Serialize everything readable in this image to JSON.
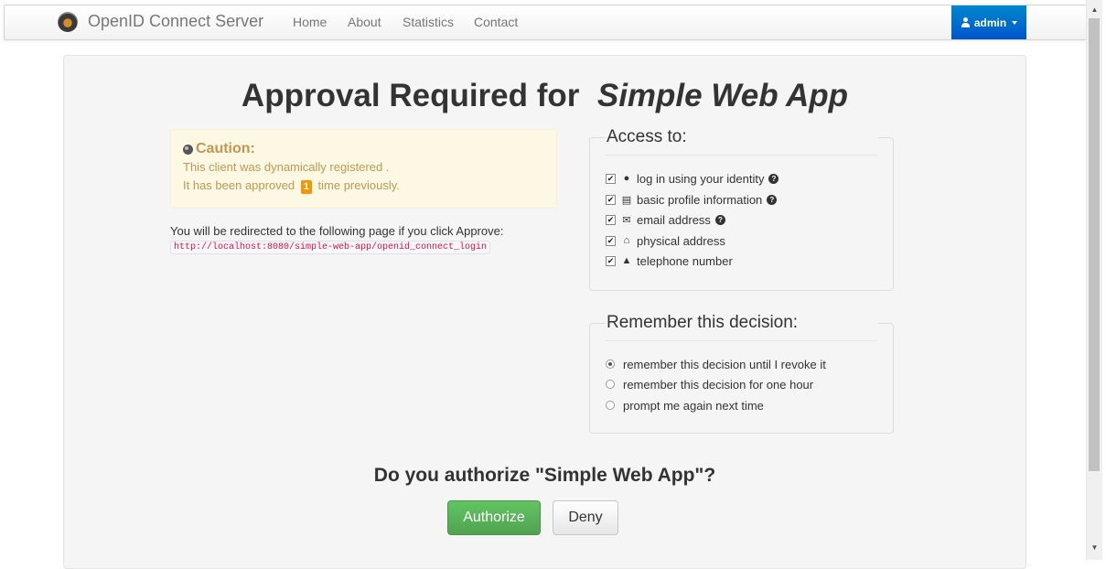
{
  "navbar": {
    "brand": "OpenID Connect Server",
    "links": [
      "Home",
      "About",
      "Statistics",
      "Contact"
    ],
    "user": "admin"
  },
  "title": {
    "prefix": "Approval Required for",
    "client_name": "Simple Web App"
  },
  "caution": {
    "heading": "Caution:",
    "line1": "This client was dynamically registered .",
    "line2_before": "It has been approved",
    "approval_count": "1",
    "line2_after": "time previously."
  },
  "redirect": {
    "text": "You will be redirected to the following page if you click Approve:",
    "url": "http://localhost:8080/simple-web-app/openid_connect_login"
  },
  "access": {
    "legend": "Access to:",
    "scopes": [
      {
        "label": "log in using your identity",
        "icon": "user-icon",
        "checked": true,
        "help": true
      },
      {
        "label": "basic profile information",
        "icon": "list-icon",
        "checked": true,
        "help": true
      },
      {
        "label": "email address",
        "icon": "envelope-icon",
        "checked": true,
        "help": true
      },
      {
        "label": "physical address",
        "icon": "home-icon",
        "checked": true,
        "help": false
      },
      {
        "label": "telephone number",
        "icon": "bell-icon",
        "checked": true,
        "help": false
      }
    ]
  },
  "remember": {
    "legend": "Remember this decision:",
    "options": [
      {
        "label": "remember this decision until I revoke it",
        "selected": true
      },
      {
        "label": "remember this decision for one hour",
        "selected": false
      },
      {
        "label": "prompt me again next time",
        "selected": false
      }
    ]
  },
  "question": "Do you authorize \"Simple Web App\"?",
  "buttons": {
    "authorize": "Authorize",
    "deny": "Deny"
  },
  "colors": {
    "accent": "#0088cc",
    "authorize": "#5bb75b",
    "caution_text": "#c09853",
    "badge": "#f89406"
  }
}
